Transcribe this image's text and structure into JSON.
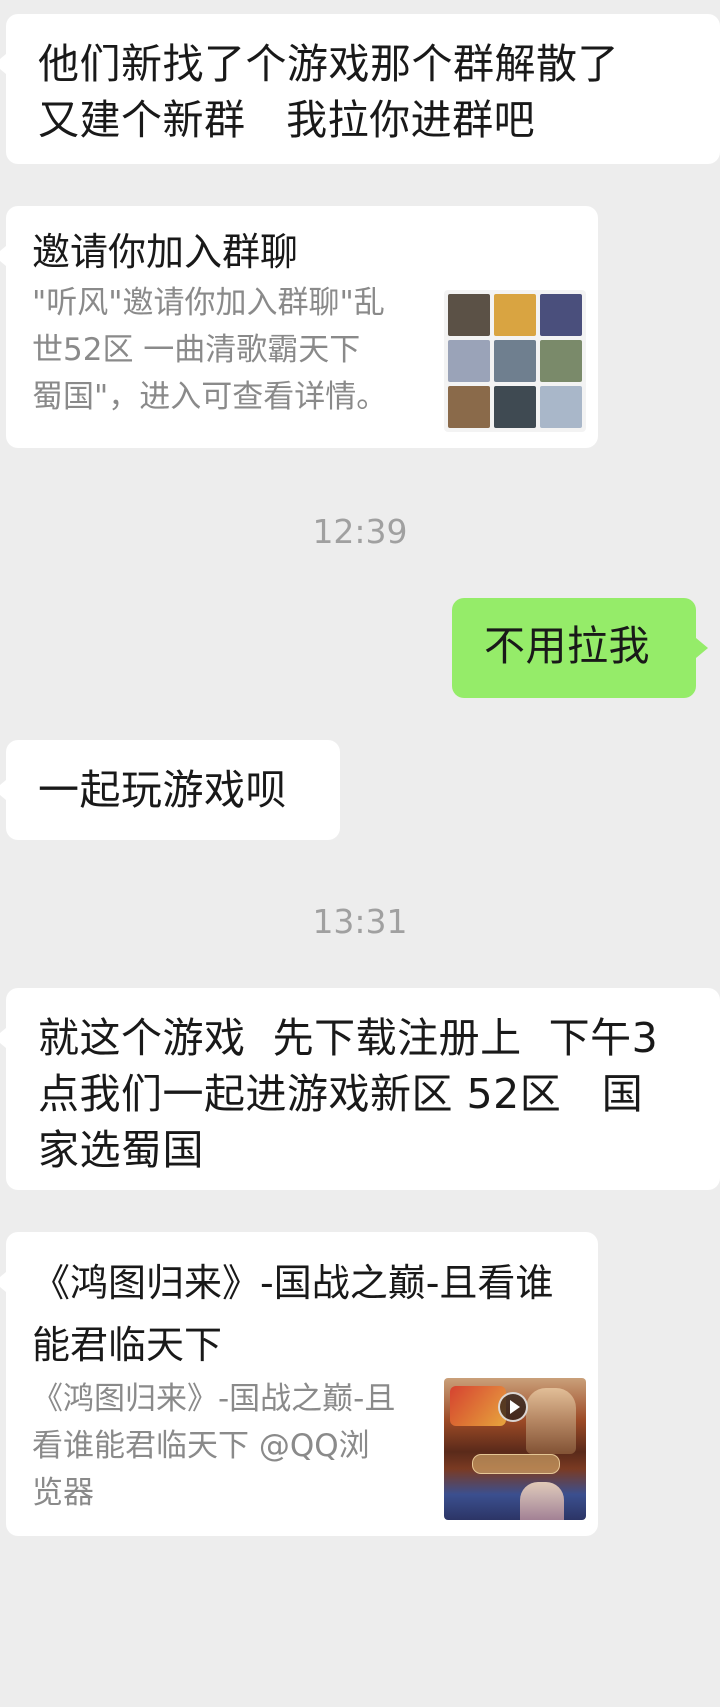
{
  "messages": [
    {
      "side": "left",
      "type": "text",
      "text": "他们新找了个游戏那个群解散了\n又建个新群   我拉你进群吧"
    },
    {
      "side": "left",
      "type": "card",
      "title": "邀请你加入群聊",
      "desc": "\"听风\"邀请你加入群聊\"乱\n世52区 一曲清歌霸天下\n蜀国\"，进入可查看详情。",
      "thumb_icon": "group-avatar-grid-icon"
    },
    {
      "type": "time",
      "text": "12:39"
    },
    {
      "side": "right",
      "type": "text",
      "text": "不用拉我"
    },
    {
      "side": "left",
      "type": "text",
      "text": "一起玩游戏呗"
    },
    {
      "type": "time",
      "text": "13:31"
    },
    {
      "side": "left",
      "type": "text",
      "text": "就这个游戏  先下载注册上  下午3\n点我们一起进游戏新区 52区   国\n家选蜀国"
    },
    {
      "side": "left",
      "type": "card",
      "title": "《鸿图归来》-国战之巅-且看谁\n能君临天下",
      "desc": "《鸿图归来》-国战之巅-且\n看谁能君临天下 @QQ浏\n览器",
      "thumb_icon": "game-video-thumbnail-icon"
    }
  ],
  "colors": {
    "background": "#ededed",
    "bubble_left": "#ffffff",
    "bubble_right": "#95ec69",
    "timestamp": "#a0a0a0",
    "card_desc": "#8a8a8a"
  },
  "avatar_grid_colors": [
    "#5b5146",
    "#d9a441",
    "#4a4f7c",
    "#9aa3b8",
    "#6f7f8f",
    "#7a8a6a",
    "#8a6a4a",
    "#3f4a52",
    "#a9b7c9"
  ]
}
